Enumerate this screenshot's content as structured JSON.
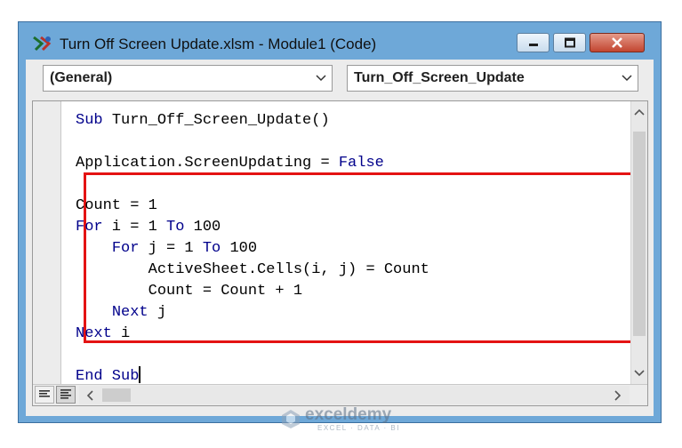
{
  "window": {
    "title": "Turn Off Screen Update.xlsm - Module1 (Code)",
    "icon": "vba-module-icon",
    "controls": [
      "minimize-icon",
      "maximize-icon",
      "close-icon"
    ]
  },
  "object_combo": {
    "value": "(General)",
    "icon": "chevron-down-icon"
  },
  "procedure_combo": {
    "value": "Turn_Off_Screen_Update",
    "icon": "chevron-down-icon"
  },
  "code": {
    "lines": [
      {
        "parts": [
          {
            "t": "Sub ",
            "k": true
          },
          {
            "t": "Turn_Off_Screen_Update()",
            "k": false
          }
        ]
      },
      {
        "parts": []
      },
      {
        "parts": [
          {
            "t": "Application.ScreenUpdating = ",
            "k": false
          },
          {
            "t": "False",
            "k": true
          }
        ]
      },
      {
        "parts": []
      },
      {
        "parts": [
          {
            "t": "Count = 1",
            "k": false
          }
        ]
      },
      {
        "parts": [
          {
            "t": "For",
            "k": true
          },
          {
            "t": " i = 1 ",
            "k": false
          },
          {
            "t": "To",
            "k": true
          },
          {
            "t": " 100",
            "k": false
          }
        ]
      },
      {
        "parts": [
          {
            "t": "    ",
            "k": false
          },
          {
            "t": "For",
            "k": true
          },
          {
            "t": " j = 1 ",
            "k": false
          },
          {
            "t": "To",
            "k": true
          },
          {
            "t": " 100",
            "k": false
          }
        ]
      },
      {
        "parts": [
          {
            "t": "        ActiveSheet.Cells(i, j) = Count",
            "k": false
          }
        ]
      },
      {
        "parts": [
          {
            "t": "        Count = Count + 1",
            "k": false
          }
        ]
      },
      {
        "parts": [
          {
            "t": "    ",
            "k": false
          },
          {
            "t": "Next",
            "k": true
          },
          {
            "t": " j",
            "k": false
          }
        ]
      },
      {
        "parts": [
          {
            "t": "Next",
            "k": true
          },
          {
            "t": " i",
            "k": false
          }
        ]
      },
      {
        "parts": []
      },
      {
        "parts": [
          {
            "t": "End Sub",
            "k": true
          }
        ],
        "caret": true
      }
    ],
    "keyword_color": "#00008b",
    "text_color": "#000000",
    "highlight": {
      "from_line": 5,
      "to_line": 11,
      "color": "#e41313"
    }
  },
  "view_buttons": [
    "procedure-view-icon",
    "full-module-view-icon"
  ],
  "scrollbars": {
    "vertical_icons": [
      "scroll-up-icon",
      "scroll-down-icon"
    ],
    "horizontal_icons": [
      "scroll-left-icon",
      "scroll-right-icon"
    ]
  },
  "watermark": {
    "name": "exceldemy",
    "tagline": "EXCEL · DATA · BI"
  },
  "colors": {
    "title_bar": "#6ea8d8",
    "close_button": "#c24530",
    "highlight_border": "#e41313"
  }
}
